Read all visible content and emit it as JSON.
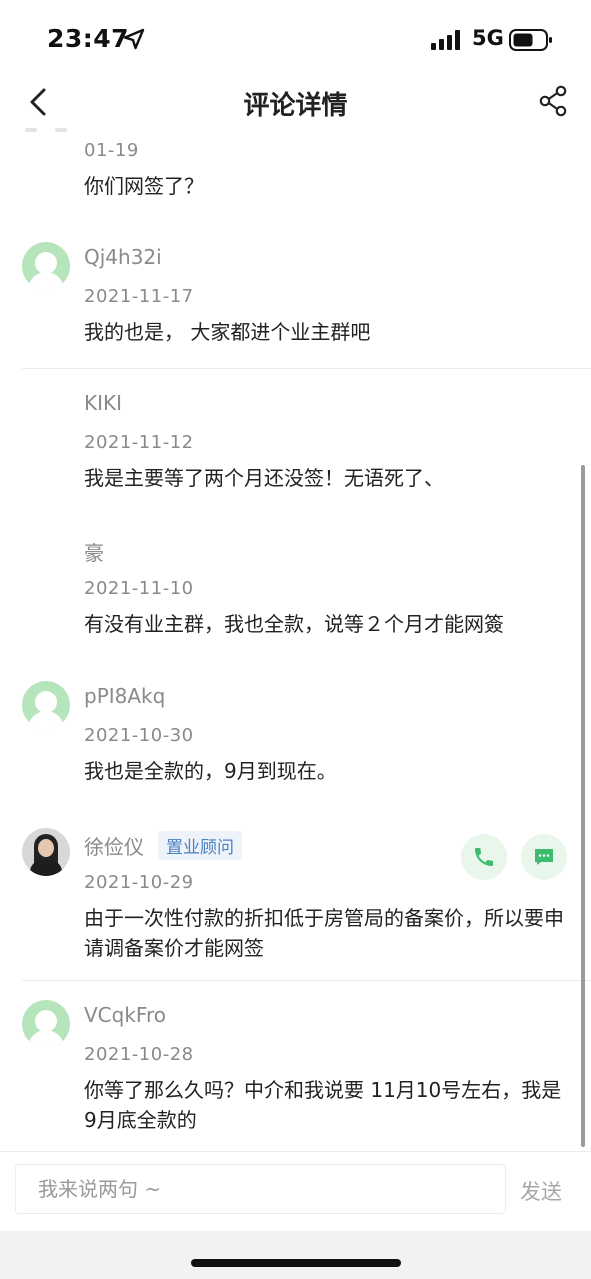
{
  "status_bar": {
    "time": "23:47",
    "network": "5G",
    "icons": [
      "location-arrow-icon",
      "signal-bars-icon",
      "battery-icon"
    ]
  },
  "nav": {
    "title": "评论详情",
    "icons": [
      "chevron-left-icon",
      "share-icon"
    ]
  },
  "comments": [
    {
      "username": "",
      "date": "01-19",
      "text": "你们网签了？",
      "avatar": "partial"
    },
    {
      "username": "Qj4h32i",
      "date": "2021-11-17",
      "text": "我的也是， 大家都进个业主群吧",
      "avatar": "default"
    },
    {
      "username": "KIKI",
      "date": "2021-11-12",
      "text": "我是主要等了两个月还没签！无语死了、",
      "avatar": "none"
    },
    {
      "username": "豪",
      "date": "2021-11-10",
      "text": "有没有业主群，我也全款，说等２个月才能网簽",
      "avatar": "none"
    },
    {
      "username": "pPI8Akq",
      "date": "2021-10-30",
      "text": "我也是全款的，9月到现在。",
      "avatar": "default"
    },
    {
      "username": "徐俭仪",
      "badge": "置业顾问",
      "date": "2021-10-29",
      "text": "由于一次性付款的折扣低于房管局的备案价，所以要申请调备案价才能网签",
      "avatar": "photo",
      "actions": [
        "phone-icon",
        "message-icon"
      ]
    },
    {
      "username": "VCqkFro",
      "date": "2021-10-28",
      "text": "你等了那么久吗？中介和我说要 11月10号左右，我是 9月底全款的",
      "avatar": "default"
    }
  ],
  "input_bar": {
    "placeholder": "我来说两句 ~",
    "send_label": "发送"
  },
  "colors": {
    "avatar_green": "#b7e5bb",
    "badge_blue": "#4a7fc1",
    "action_green": "#3dbb6e",
    "muted_gray": "#8a8a8a"
  }
}
